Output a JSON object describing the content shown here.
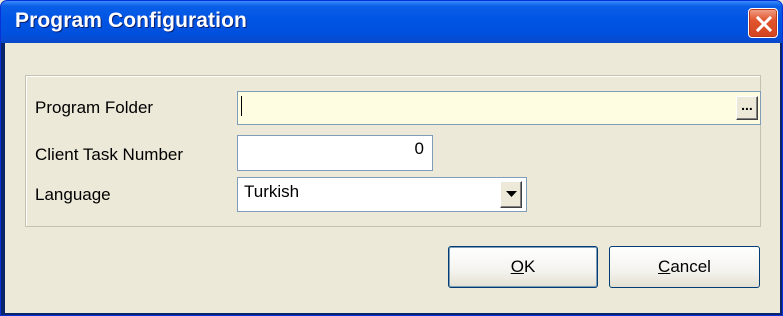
{
  "window": {
    "title": "Program Configuration"
  },
  "form": {
    "program_folder": {
      "label": "Program Folder",
      "value": "",
      "browse_label": "..."
    },
    "client_task_number": {
      "label": "Client Task Number",
      "value": "0"
    },
    "language": {
      "label": "Language",
      "selected": "Turkish"
    }
  },
  "buttons": {
    "ok": {
      "mnemonic": "O",
      "rest": "K"
    },
    "cancel": {
      "mnemonic": "C",
      "rest": "ancel"
    }
  },
  "icons": {
    "close": "close-icon",
    "dropdown": "chevron-down-icon"
  },
  "colors": {
    "titlebar": "#0054e3",
    "close_button": "#e2552e",
    "dialog_background": "#ece9d8",
    "folder_field_background": "#fffde1"
  }
}
